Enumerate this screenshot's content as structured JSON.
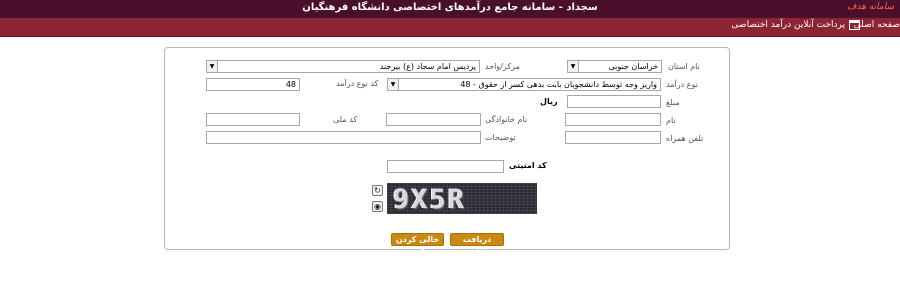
{
  "header": {
    "title": "سجداد - سامانه جامع درآمدهای اختصاصی دانشگاه فرهنگیان",
    "brand": "سامانه هدف"
  },
  "nav": {
    "home": "صفحه اصلی",
    "online_payment": "پرداخت آنلاین درآمد اختصاصی"
  },
  "form": {
    "province_label": "نام استان",
    "province_value": "خراسان جنوبی",
    "center_label": "مرکز/واحد",
    "center_value": "پردیس امام سجاد (ع) بیرجند",
    "income_type_label": "نوع درآمد",
    "income_type_value": "48 - واریز وجه توسط دانشجویان بابت بدهی کسر از حقوق",
    "income_code_label": "کد نوع درآمد",
    "income_code_value": "48",
    "amount_label": "مبلغ",
    "amount_value": "",
    "currency": "ریال",
    "first_name_label": "نام",
    "first_name_value": "",
    "last_name_label": "نام خانوادگی",
    "last_name_value": "",
    "national_id_label": "کد ملی",
    "national_id_value": "",
    "mobile_label": "تلفن همراه",
    "mobile_value": "",
    "description_label": "توضیحات",
    "description_value": "",
    "security_code_label": "کد امنیتی",
    "security_code_value": "",
    "captcha_text": "9X5R"
  },
  "buttons": {
    "get_id": "دریافت شناسه",
    "clear_form": "خالی کردن فرم"
  },
  "colors": {
    "top_bar": "#4a0f2b",
    "nav_bar": "#8c2434",
    "button": "#c98a14"
  }
}
